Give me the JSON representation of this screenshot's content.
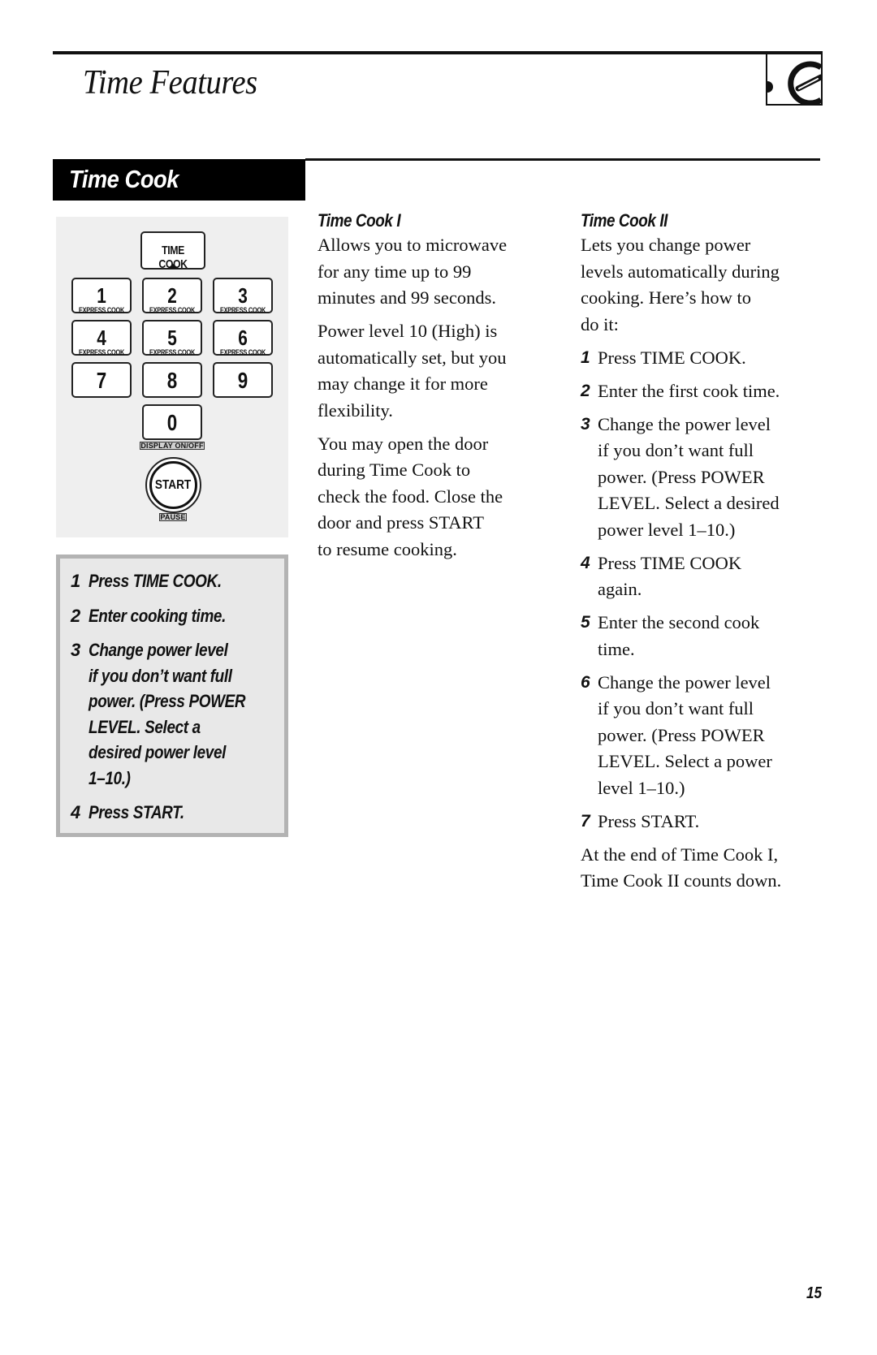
{
  "header": {
    "title": "Time Features",
    "icon": "microwave-timer-dial-icon"
  },
  "section": {
    "title": "Time Cook"
  },
  "keypad": {
    "time_cook_key": "TIME COOK",
    "express_label": "EXPRESS COOK",
    "keys": [
      {
        "num": "1",
        "sub": "EXPRESS COOK"
      },
      {
        "num": "2",
        "sub": "EXPRESS COOK"
      },
      {
        "num": "3",
        "sub": "EXPRESS COOK"
      },
      {
        "num": "4",
        "sub": "EXPRESS COOK"
      },
      {
        "num": "5",
        "sub": "EXPRESS COOK"
      },
      {
        "num": "6",
        "sub": "EXPRESS COOK"
      },
      {
        "num": "7"
      },
      {
        "num": "8"
      },
      {
        "num": "9"
      },
      {
        "num": "0"
      }
    ],
    "display_label": "DISPLAY ON/OFF",
    "start_key": "START",
    "pause_label": "PAUSE"
  },
  "quick_steps": [
    {
      "n": "1",
      "text": "Press TIME COOK."
    },
    {
      "n": "2",
      "text": "Enter cooking time."
    },
    {
      "n": "3",
      "text": "Change power level\nif you don’t want full\npower. (Press POWER\nLEVEL. Select a\ndesired power level\n1–10.)"
    },
    {
      "n": "4",
      "text": "Press START."
    }
  ],
  "time_cook_1": {
    "heading": "Time Cook I",
    "paragraphs": [
      "Allows you to microwave\nfor any time up to 99\nminutes and 99 seconds.",
      "Power level 10 (High) is\nautomatically set, but you\nmay change it for more\nflexibility.",
      "You may open the door\nduring Time Cook to\ncheck the food. Close the\ndoor and press START\nto resume cooking."
    ]
  },
  "time_cook_2": {
    "heading": "Time Cook II",
    "intro": "Lets you change power\nlevels automatically during\ncooking. Here’s how to\ndo it:",
    "steps": [
      {
        "n": "1",
        "text": "Press TIME COOK."
      },
      {
        "n": "2",
        "text": "Enter the first cook time."
      },
      {
        "n": "3",
        "text": "Change the power level\nif you don’t want full\npower. (Press POWER\nLEVEL. Select a desired\npower level 1–10.)"
      },
      {
        "n": "4",
        "text": "Press TIME COOK\nagain."
      },
      {
        "n": "5",
        "text": "Enter the second cook\ntime."
      },
      {
        "n": "6",
        "text": "Change the power level\nif you don’t want full\npower. (Press POWER\nLEVEL. Select a power\nlevel 1–10.)"
      },
      {
        "n": "7",
        "text": "Press START."
      }
    ],
    "outro": "At the end of Time Cook I,\nTime Cook II counts down."
  },
  "page_number": "15"
}
